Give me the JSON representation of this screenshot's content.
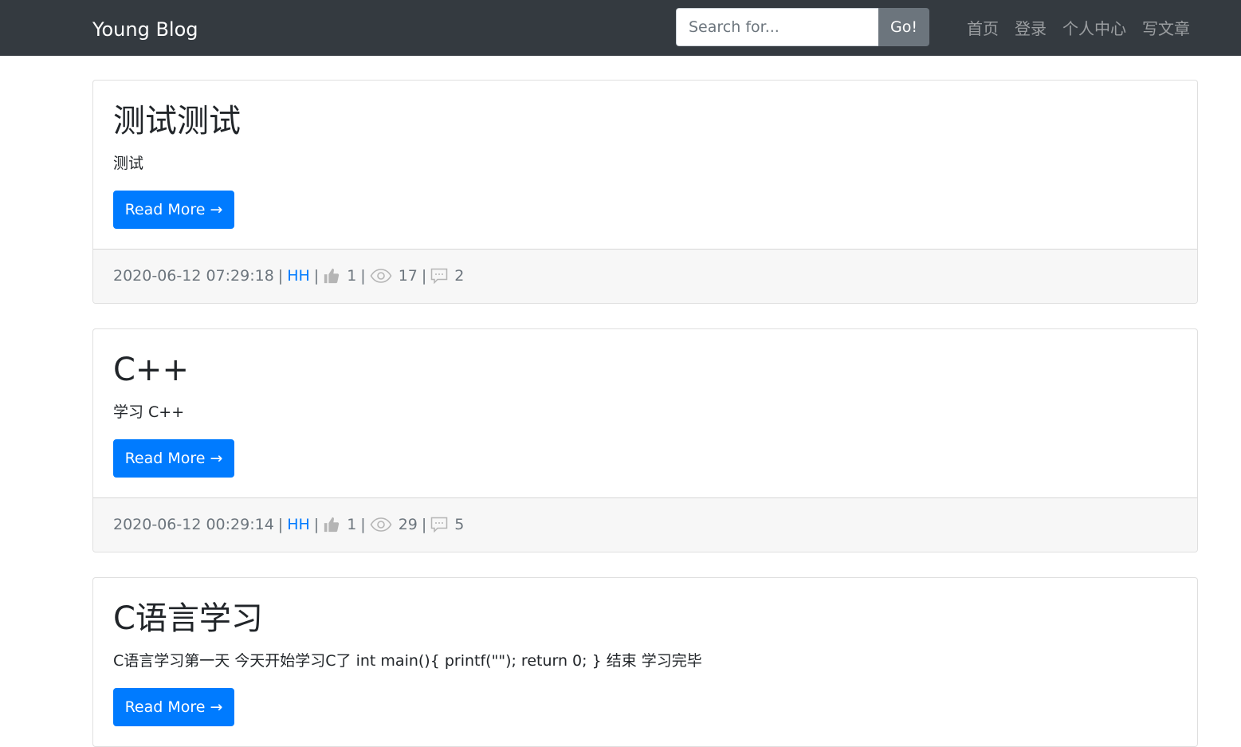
{
  "navbar": {
    "brand": "Young Blog",
    "search_placeholder": "Search for...",
    "search_button": "Go!",
    "links": [
      "首页",
      "登录",
      "个人中心",
      "写文章"
    ]
  },
  "posts": [
    {
      "title": "测试测试",
      "summary": "测试",
      "read_more": "Read More →",
      "date": "2020-06-12 07:29:18",
      "author": "HH",
      "likes": "1",
      "views": "17",
      "comments": "2"
    },
    {
      "title": "C++",
      "summary": "学习 C++",
      "read_more": "Read More →",
      "date": "2020-06-12 00:29:14",
      "author": "HH",
      "likes": "1",
      "views": "29",
      "comments": "5"
    },
    {
      "title": "C语言学习",
      "summary": "C语言学习第一天 今天开始学习C了 int main(){ printf(\"\"); return 0; } 结束 学习完毕",
      "read_more": "Read More →",
      "date": "",
      "author": "",
      "likes": "",
      "views": "",
      "comments": ""
    }
  ],
  "separator": "|",
  "colors": {
    "navbar_bg": "#343a40",
    "primary": "#007bff",
    "secondary": "#6c757d",
    "footer_bg": "#f7f7f7"
  },
  "icons": {
    "like": "thumbs-up-icon",
    "views": "eye-icon",
    "comments": "comment-icon"
  }
}
